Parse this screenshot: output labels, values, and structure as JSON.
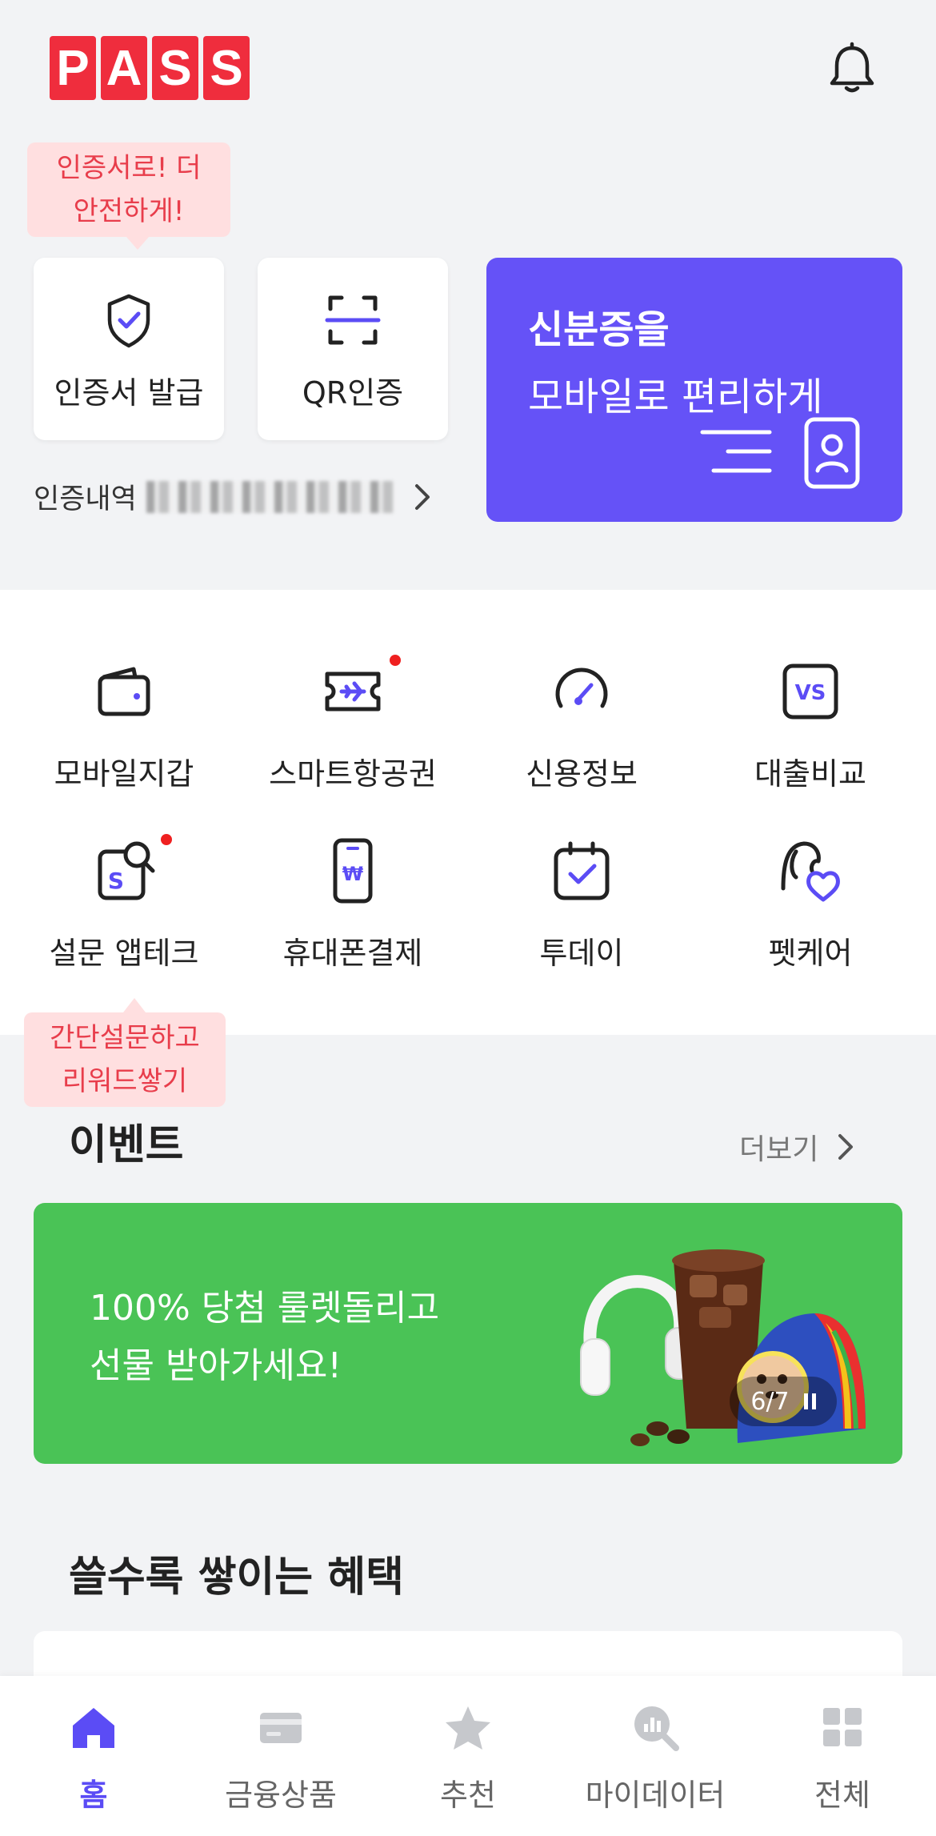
{
  "header": {
    "logo_letters": [
      "P",
      "A",
      "S",
      "S"
    ],
    "logo_color": "#ef2d3d",
    "bell_icon": "bell-icon"
  },
  "auth": {
    "tooltip_line1": "인증서로! 더",
    "tooltip_line2": "안전하게!",
    "cert_issue_label": "인증서 발급",
    "qr_auth_label": "QR인증",
    "history_label": "인증내역"
  },
  "id_banner": {
    "line1": "신분증을",
    "line2": "모바일로 편리하게",
    "color": "#6552f7"
  },
  "menu": {
    "items": [
      {
        "label": "모바일지갑",
        "icon": "wallet-icon",
        "new": false
      },
      {
        "label": "스마트항공권",
        "icon": "plane-ticket-icon",
        "new": true
      },
      {
        "label": "신용정보",
        "icon": "gauge-icon",
        "new": false
      },
      {
        "label": "대출비교",
        "icon": "vs-icon",
        "new": false
      },
      {
        "label": "설문 앱테크",
        "icon": "survey-search-icon",
        "new": true
      },
      {
        "label": "휴대폰결제",
        "icon": "phone-won-icon",
        "new": false
      },
      {
        "label": "투데이",
        "icon": "calendar-check-icon",
        "new": false
      },
      {
        "label": "펫케어",
        "icon": "pet-heart-icon",
        "new": false
      }
    ],
    "survey_tooltip_line1": "간단설문하고",
    "survey_tooltip_line2": "리워드쌓기"
  },
  "events": {
    "title": "이벤트",
    "more_label": "더보기",
    "banner_line1": "100% 당첨 룰렛돌리고",
    "banner_line2": "선물 받아가세요!",
    "banner_color": "#4ac356",
    "counter": "6/7"
  },
  "benefits": {
    "title": "쓸수록 쌓이는 혜택"
  },
  "bottom_nav": {
    "items": [
      {
        "label": "홈",
        "icon": "home-icon",
        "active": true
      },
      {
        "label": "금융상품",
        "icon": "card-icon",
        "active": false
      },
      {
        "label": "추천",
        "icon": "star-icon",
        "active": false
      },
      {
        "label": "마이데이터",
        "icon": "mydata-icon",
        "active": false
      },
      {
        "label": "전체",
        "icon": "grid-icon",
        "active": false
      }
    ],
    "active_color": "#5b4cf5"
  }
}
